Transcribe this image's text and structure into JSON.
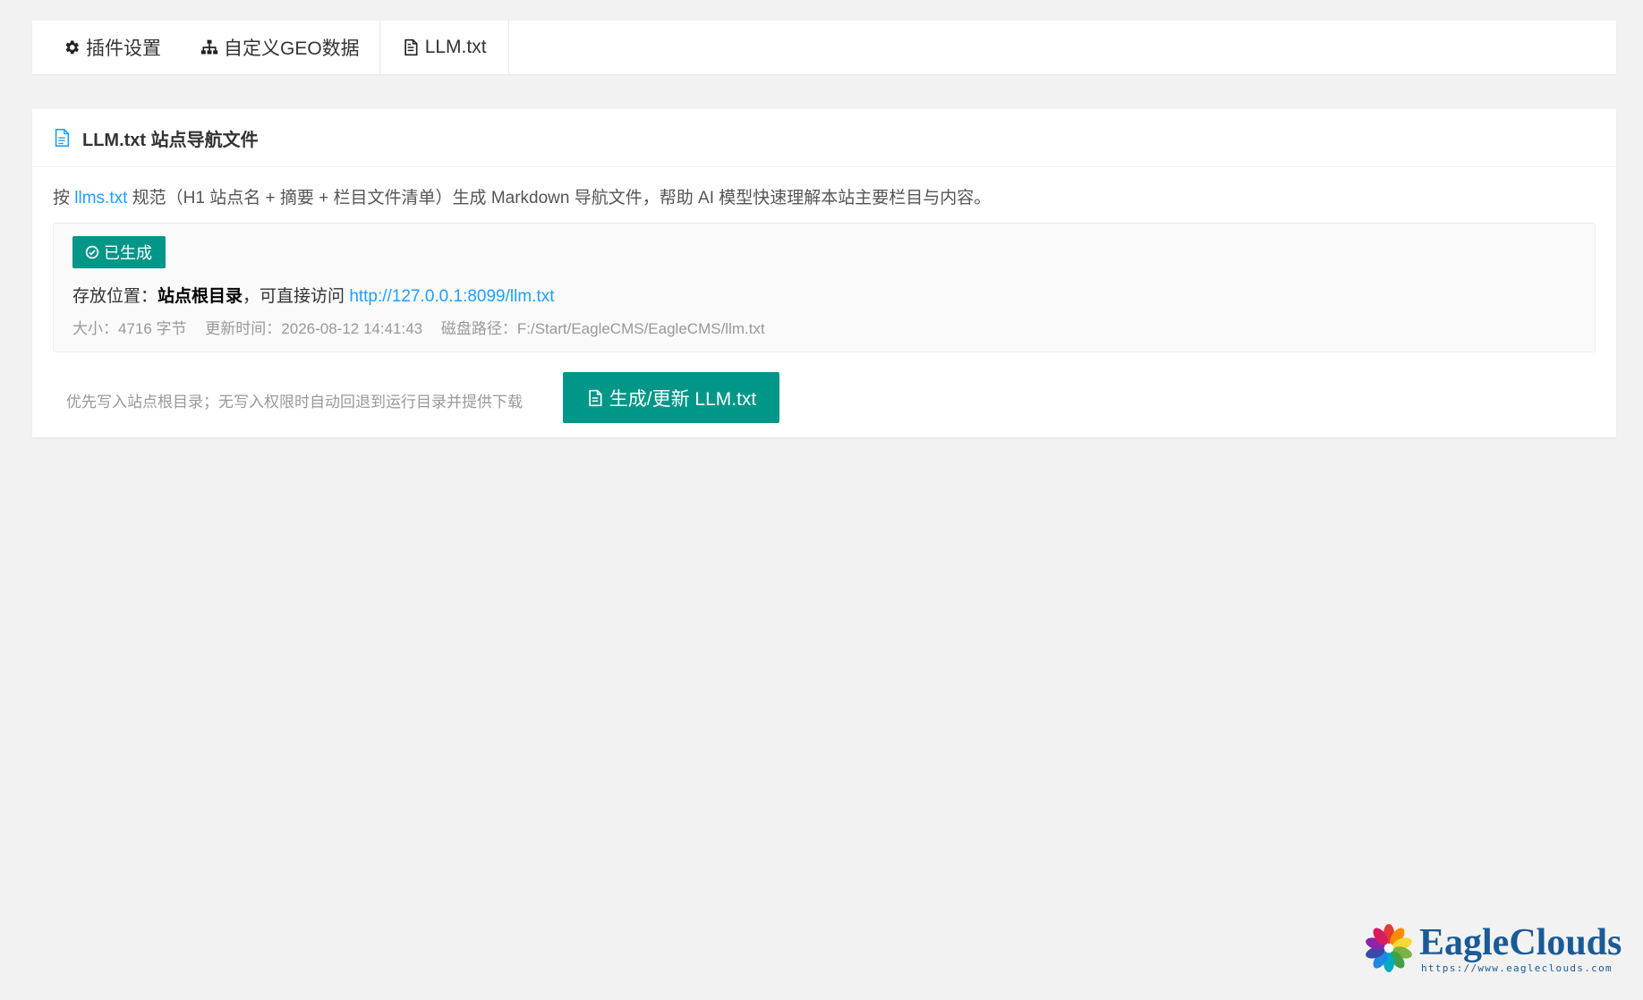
{
  "tabs": [
    {
      "label": "插件设置",
      "icon": "gear-icon"
    },
    {
      "label": "自定义GEO数据",
      "icon": "sitemap-icon"
    },
    {
      "label": "LLM.txt",
      "icon": "file-text-icon"
    }
  ],
  "card": {
    "title": "LLM.txt 站点导航文件",
    "desc_prefix": "按 ",
    "desc_link": "llms.txt",
    "desc_suffix": " 规范（H1 站点名 + 摘要 + 栏目文件清单）生成 Markdown 导航文件，帮助 AI 模型快速理解本站主要栏目与内容。",
    "status_badge": "已生成",
    "location_label": "存放位置：",
    "location_value": "站点根目录",
    "location_mid": "，可直接访问 ",
    "location_url": "http://127.0.0.1:8099/llm.txt",
    "size": "大小：4716 字节",
    "updated": "更新时间：2026-08-12 14:41:43",
    "disk_path": "磁盘路径：F:/Start/EagleCMS/EagleCMS/llm.txt",
    "hint": "优先写入站点根目录；无写入权限时自动回退到运行目录并提供下载",
    "generate_button": "生成/更新 LLM.txt"
  },
  "logo": {
    "name": "EagleClouds",
    "url": "https://www.eagleclouds.com"
  },
  "colors": {
    "primary": "#009688",
    "link": "#1e9fff",
    "background": "#f2f2f2"
  }
}
